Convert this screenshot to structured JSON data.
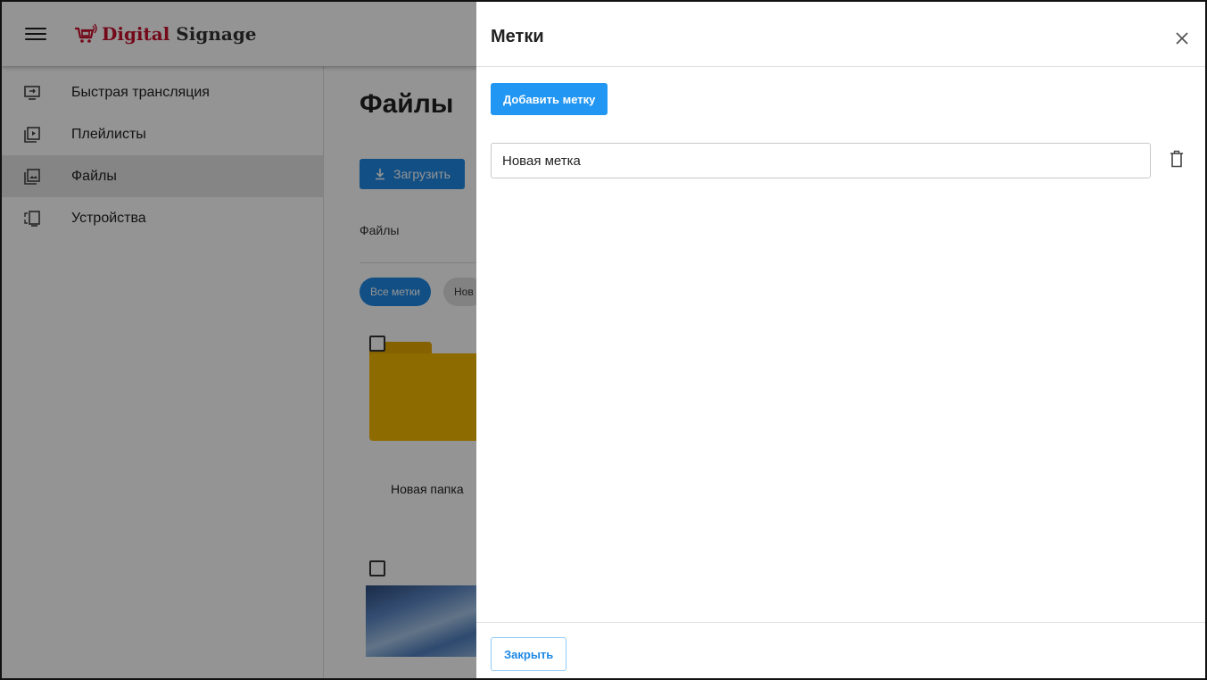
{
  "app": {
    "logo_digital": "Digital",
    "logo_signage": "Signage"
  },
  "sidebar": {
    "items": [
      {
        "label": "Быстрая трансляция",
        "icon": "screen-cast-icon"
      },
      {
        "label": "Плейлисты",
        "icon": "playlist-icon"
      },
      {
        "label": "Файлы",
        "icon": "image-files-icon",
        "active": true
      },
      {
        "label": "Устройства",
        "icon": "devices-icon"
      }
    ]
  },
  "main": {
    "title": "Файлы",
    "upload_label": "Загрузить",
    "files_label": "Файлы",
    "chips": [
      "Все метки",
      "Нов"
    ],
    "folder_name": "Новая папка"
  },
  "drawer": {
    "title": "Метки",
    "add_label": "Добавить метку",
    "tag_value": "Новая метка",
    "close_label": "Закрыть"
  },
  "colors": {
    "primary": "#2196f3",
    "brand_red": "#c8102e",
    "folder": "#f5b800"
  }
}
